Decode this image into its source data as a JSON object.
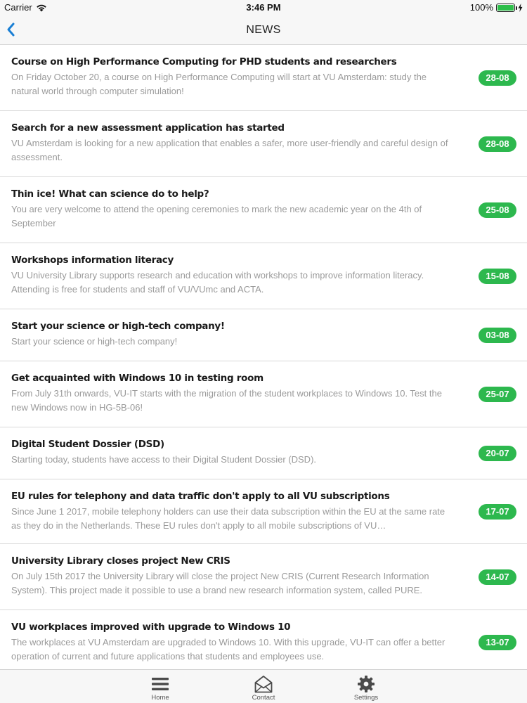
{
  "status_bar": {
    "carrier": "Carrier",
    "time": "3:46 PM",
    "battery_text": "100%",
    "battery_level": 1.0
  },
  "nav": {
    "title": "NEWS",
    "back_icon": "chevron-left-icon",
    "accent_color": "#1a7fd4"
  },
  "news": [
    {
      "title": "Course on High Performance Computing for PHD students and researchers",
      "summary": "On Friday October 20, a course on High Performance Computing will start at VU Amsterdam: study the natural world through computer simulation!",
      "date": "28-08"
    },
    {
      "title": "Search for a new assessment application has started",
      "summary": "VU Amsterdam is looking for a new application that enables a safer, more user-friendly and careful design of assessment.",
      "date": "28-08"
    },
    {
      "title": "Thin ice! What can science do to help?",
      "summary": "You are very welcome to attend the opening ceremonies to mark the new academic year on the 4th of September",
      "date": "25-08"
    },
    {
      "title": "Workshops information literacy",
      "summary": "VU University Library supports research and education with workshops to improve information literacy. Attending is free for students and staff of VU/VUmc and ACTA.",
      "date": "15-08"
    },
    {
      "title": "Start your science or high-tech company!",
      "summary": "Start your science or high-tech company!",
      "date": "03-08"
    },
    {
      "title": "Get acquainted with Windows 10 in testing room",
      "summary": "From July 31th onwards, VU-IT starts with the migration of the student workplaces to Windows 10. Test the new Windows now in HG-5B-06!",
      "date": "25-07"
    },
    {
      "title": "Digital Student Dossier (DSD)",
      "summary": "Starting today, students have access to their Digital Student Dossier (DSD).",
      "date": "20-07"
    },
    {
      "title": "EU rules for telephony and data traffic don't apply to all VU subscriptions",
      "summary": "Since June 1 2017, mobile telephony holders can use their data subscription within the EU at the same rate as they do in the Netherlands. These EU rules don't apply to all mobile subscriptions of VU…",
      "date": "17-07"
    },
    {
      "title": "University Library closes project New CRIS",
      "summary": "On July 15th 2017 the University Library will close the project New CRIS (Current Research Information System). This project made it possible to use a brand new research information system, called PURE.",
      "date": "14-07"
    },
    {
      "title": "VU workplaces improved with upgrade to Windows 10",
      "summary": "The workplaces at VU Amsterdam are upgraded to Windows 10. With this upgrade, VU-IT can offer a better operation of current and future applications that students and employees use.",
      "date": "13-07"
    }
  ],
  "badge_color": "#2db84e",
  "tabs": [
    {
      "label": "Home",
      "icon": "menu-icon"
    },
    {
      "label": "Contact",
      "icon": "envelope-icon"
    },
    {
      "label": "Settings",
      "icon": "gear-icon"
    }
  ]
}
